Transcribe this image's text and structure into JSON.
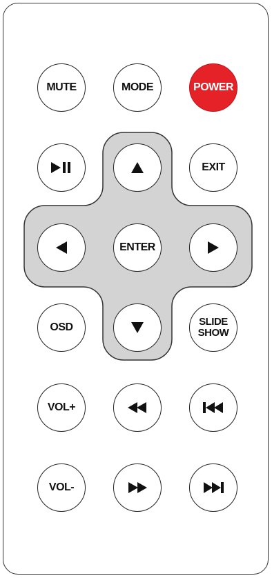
{
  "remote": {
    "row1": {
      "mute": "MUTE",
      "mode": "MODE",
      "power": "POWER"
    },
    "row2": {
      "play_pause_icon": "play-pause-icon",
      "up_icon": "arrow-up-icon",
      "exit": "EXIT"
    },
    "row3": {
      "left_icon": "arrow-left-icon",
      "enter": "ENTER",
      "right_icon": "arrow-right-icon"
    },
    "row4": {
      "osd": "OSD",
      "down_icon": "arrow-down-icon",
      "slideshow_line1": "SLIDE",
      "slideshow_line2": "SHOW"
    },
    "row5": {
      "vol_up": "VOL+",
      "rewind_icon": "rewind-icon",
      "previous_icon": "skip-previous-icon"
    },
    "row6": {
      "vol_down": "VOL-",
      "fast_forward_icon": "fast-forward-icon",
      "next_icon": "skip-next-icon"
    },
    "colors": {
      "power": "#e52228",
      "dpad": "#d3d3d3",
      "outline": "#222222"
    }
  }
}
